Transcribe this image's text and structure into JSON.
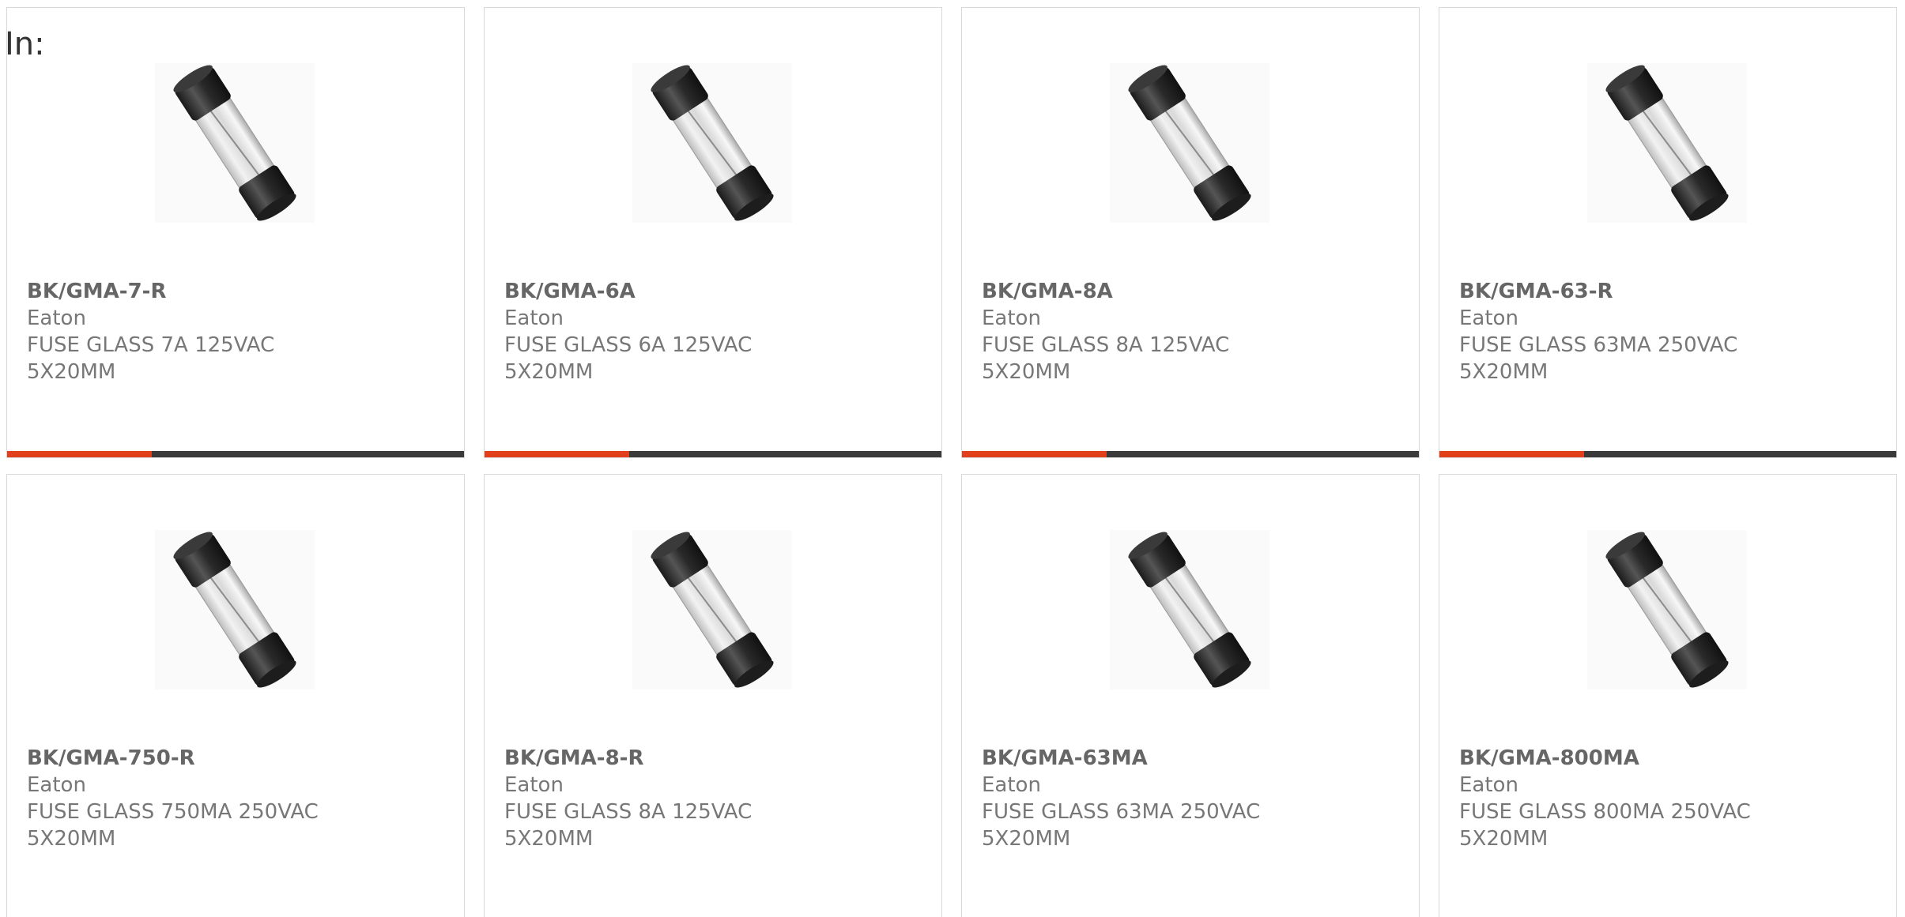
{
  "page": {
    "label": "In:"
  },
  "colors": {
    "accent": "#e2401c",
    "bar_dark": "#3a3a3a",
    "border": "#d8d8d8",
    "text": "#777777"
  },
  "products": [
    {
      "part_number": "BK/GMA-7-R",
      "manufacturer": "Eaton",
      "description": "FUSE GLASS 7A 125VAC 5X20MM",
      "image_icon": "glass-fuse-icon"
    },
    {
      "part_number": "BK/GMA-6A",
      "manufacturer": "Eaton",
      "description": "FUSE GLASS 6A 125VAC 5X20MM",
      "image_icon": "glass-fuse-icon"
    },
    {
      "part_number": "BK/GMA-8A",
      "manufacturer": "Eaton",
      "description": "FUSE GLASS 8A 125VAC 5X20MM",
      "image_icon": "glass-fuse-icon"
    },
    {
      "part_number": "BK/GMA-63-R",
      "manufacturer": "Eaton",
      "description": "FUSE GLASS 63MA 250VAC 5X20MM",
      "image_icon": "glass-fuse-icon"
    },
    {
      "part_number": "BK/GMA-750-R",
      "manufacturer": "Eaton",
      "description": "FUSE GLASS 750MA 250VAC 5X20MM",
      "image_icon": "glass-fuse-icon"
    },
    {
      "part_number": "BK/GMA-8-R",
      "manufacturer": "Eaton",
      "description": "FUSE GLASS 8A 125VAC 5X20MM",
      "image_icon": "glass-fuse-icon"
    },
    {
      "part_number": "BK/GMA-63MA",
      "manufacturer": "Eaton",
      "description": "FUSE GLASS 63MA 250VAC 5X20MM",
      "image_icon": "glass-fuse-icon"
    },
    {
      "part_number": "BK/GMA-800MA",
      "manufacturer": "Eaton",
      "description": "FUSE GLASS 800MA 250VAC 5X20MM",
      "image_icon": "glass-fuse-icon"
    }
  ]
}
